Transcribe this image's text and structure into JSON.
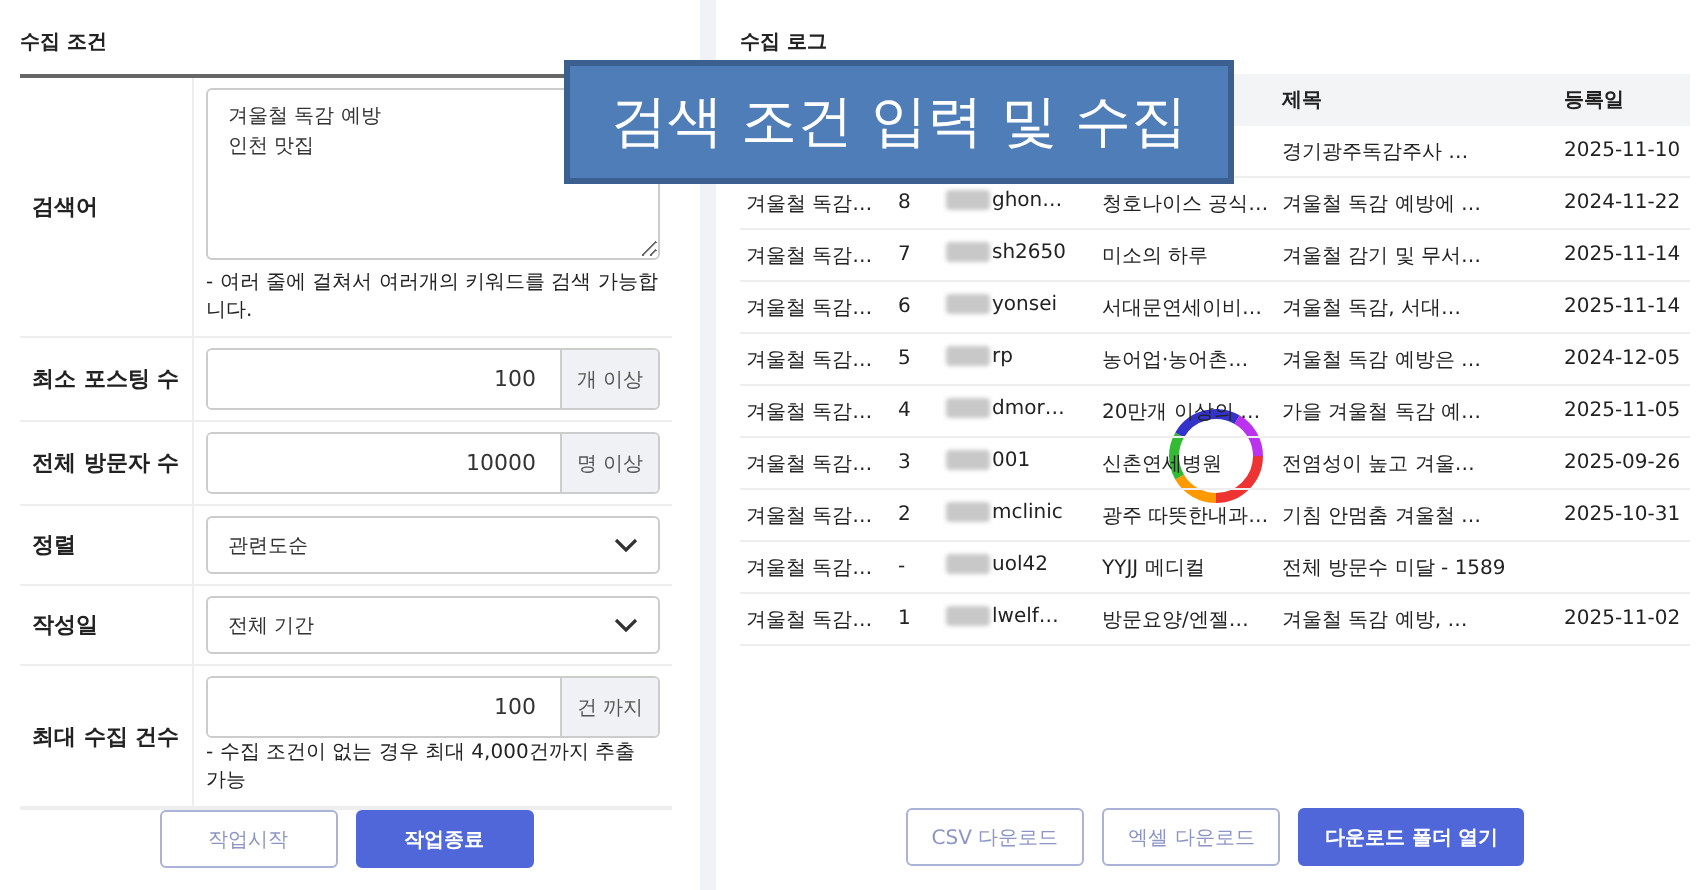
{
  "conditions": {
    "title": "수집 조건",
    "fields": [
      {
        "kind": "textarea",
        "label": "검색어",
        "value": "겨울철 독감 예방\n인천 맛집",
        "help": "- 여러 줄에 걸쳐서 여러개의 키워드를 검색 가능합니다."
      },
      {
        "kind": "number",
        "label": "최소 포스팅 수",
        "value": "100",
        "unit": "개 이상"
      },
      {
        "kind": "number",
        "label": "전체 방문자 수",
        "value": "10000",
        "unit": "명 이상"
      },
      {
        "kind": "select",
        "label": "정렬",
        "value": "관련도순"
      },
      {
        "kind": "select",
        "label": "작성일",
        "value": "전체 기간"
      },
      {
        "kind": "number",
        "label": "최대 수집 건수",
        "value": "100",
        "unit": "건 까지",
        "help": "- 수집 조건이 없는 경우 최대 4,000건까지 추출 가능"
      }
    ],
    "buttons": [
      {
        "label": "작업시작",
        "kind": "outline"
      },
      {
        "label": "작업종료",
        "kind": "primary"
      }
    ]
  },
  "log": {
    "title": "수집 로그",
    "columns": [
      "제목",
      "등록일"
    ],
    "rows": [
      {
        "title": "경기광주독감주사 …",
        "date": "2025-11-10"
      },
      {
        "keyword": "겨울철 독감…",
        "rank": "8",
        "id": "ghon…",
        "blog": "청호나이스 공식…",
        "title": "겨울철 독감 예방에 …",
        "date": "2024-11-22"
      },
      {
        "keyword": "겨울철 독감…",
        "rank": "7",
        "id": "sh2650",
        "blog": "미소의 하루",
        "title": "겨울철 감기 및 무서…",
        "date": "2025-11-14"
      },
      {
        "keyword": "겨울철 독감…",
        "rank": "6",
        "id": "yonsei",
        "blog": "서대문연세이비…",
        "title": "겨울철 독감, 서대…",
        "date": "2025-11-14"
      },
      {
        "keyword": "겨울철 독감…",
        "rank": "5",
        "id": "rp",
        "blog": "농어업·농어촌…",
        "title": "겨울철 독감 예방은 …",
        "date": "2024-12-05"
      },
      {
        "keyword": "겨울철 독감…",
        "rank": "4",
        "id": "dmor…",
        "blog": "20만개 이상의 …",
        "title": "가을 겨울철 독감 예…",
        "date": "2025-11-05"
      },
      {
        "keyword": "겨울철 독감…",
        "rank": "3",
        "id": "001",
        "blog": "신촌연세병원",
        "title": "전염성이 높고 겨울…",
        "date": "2025-09-26"
      },
      {
        "keyword": "겨울철 독감…",
        "rank": "2",
        "id": "mclinic",
        "blog": "광주 따뜻한내과…",
        "title": "기침 안멈춤 겨울철 …",
        "date": "2025-10-31"
      },
      {
        "keyword": "겨울철 독감…",
        "rank": "-",
        "id": "uol42",
        "blog": "YYJJ 메디컬",
        "title": "전체 방문수 미달 - 1589"
      },
      {
        "keyword": "겨울철 독감…",
        "rank": "1",
        "id": "lwelf…",
        "blog": "방문요양/엔젤…",
        "title": "겨울철 독감 예방, …",
        "date": "2025-11-02"
      }
    ],
    "buttons": [
      {
        "label": "CSV 다운로드",
        "kind": "outline"
      },
      {
        "label": "엑셀 다운로드",
        "kind": "outline"
      },
      {
        "label": "다운로드 폴더 열기",
        "kind": "primary"
      }
    ]
  },
  "banner": {
    "text": "검색 조건 입력 및 수집"
  }
}
